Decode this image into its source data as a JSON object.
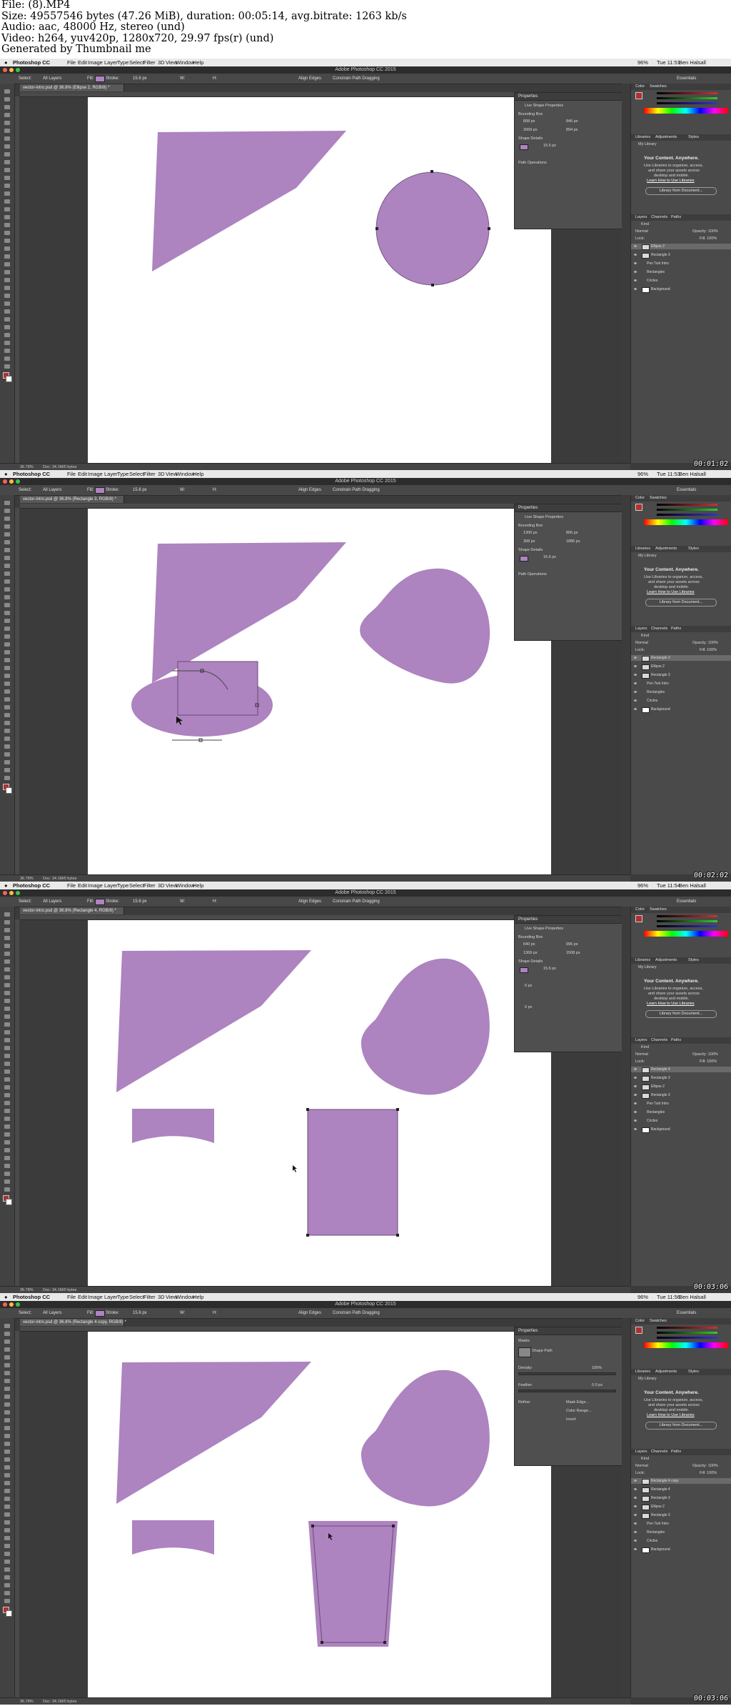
{
  "header": {
    "lines": [
      "File: (8).MP4",
      "Size: 49557546 bytes (47.26 MiB), duration: 00:05:14, avg.bitrate: 1263 kb/s",
      "Audio: aac, 48000 Hz, stereo (und)",
      "Video: h264, yuv420p, 1280x720, 29.97 fps(r) (und)",
      "Generated by Thumbnail me"
    ]
  },
  "app": {
    "title": "Adobe Photoshop CC 2015",
    "app_name": "Photoshop CC",
    "menus": [
      "File",
      "Edit",
      "Image",
      "Layer",
      "Type",
      "Select",
      "Filter",
      "3D",
      "View",
      "Window",
      "Help"
    ],
    "user": "Ben Halsall",
    "battery": "96%",
    "workspace": "Essentials",
    "options": {
      "select_label": "Select:",
      "select_value": "All Layers",
      "fill_label": "Fill:",
      "stroke_label": "Stroke:",
      "stroke_width": "15.6 px",
      "w_label": "W:",
      "h_label": "H:",
      "align_edges": "Align Edges",
      "constrain": "Constrain Path Dragging"
    },
    "accent_purple": "#ad83c0"
  },
  "panels": {
    "color_tab": "Color",
    "swatches_tab": "Swatches",
    "libraries_tab": "Libraries",
    "adjustments_tab": "Adjustments",
    "styles_tab": "Styles",
    "my_library": "My Library",
    "your_content": "Your Content. Anywhere.",
    "lib_text_1": "Use Libraries to organize, access,",
    "lib_text_2": "and share your assets across",
    "lib_text_3": "desktop and mobile.",
    "learn_link": "Learn How to Use Libraries",
    "lib_button": "Library from Document...",
    "layers_tab": "Layers",
    "channels_tab": "Channels",
    "paths_tab": "Paths",
    "kind": "Kind",
    "blend": "Normal",
    "opacity": "Opacity: 100%",
    "fill": "Fill: 100%",
    "lock": "Lock:"
  },
  "properties_panel": {
    "title": "Properties",
    "live_shape": "Live Shape Properties",
    "bounding_box": "Bounding Box",
    "shape_details": "Shape Details",
    "path_ops": "Path Operations",
    "stroke": "15.6 px",
    "masks": "Masks",
    "shape_path": "Shape Path",
    "density": "Density:",
    "density_value": "100%",
    "feather": "Feather:",
    "feather_value": "0.0 px",
    "refine": "Refine:",
    "mask_edge": "Mask Edge...",
    "color_range": "Color Range...",
    "invert": "Invert"
  },
  "frames": [
    {
      "timestamp": "00:01:02",
      "clock": "Tue 11:51",
      "doc_tab": "vector-intro.psd @ 36.8% (Ellipse 2, RGB/8) *",
      "zoom": "36.78%",
      "doc_info": "Doc: 34.1M/0 bytes",
      "props_mode": "live",
      "props_values": {
        "w": "808 px",
        "h": "846 px",
        "x": "2069 px",
        "y": "894 px"
      },
      "layers": [
        "Ellipse 2",
        "Rectangle 3",
        "Pen Tool Intro",
        "Rectangles",
        "Circles",
        "Background"
      ],
      "selected_layer": 0
    },
    {
      "timestamp": "00:02:02",
      "clock": "Tue 11:53",
      "doc_tab": "vector-intro.psd @ 36.8% (Rectangle 3, RGB/8) *",
      "zoom": "36.78%",
      "doc_info": "Doc: 34.1M/0 bytes",
      "props_mode": "live",
      "props_values": {
        "w": "1300 px",
        "h": "806 px",
        "x": "308 px",
        "y": "1886 px"
      },
      "layers": [
        "Rectangle 3",
        "Ellipse 2",
        "Rectangle 3",
        "Pen Tool Intro",
        "Rectangles",
        "Circles",
        "Background"
      ],
      "selected_layer": 0
    },
    {
      "timestamp": "00:03:06",
      "clock": "Tue 11:54",
      "doc_tab": "vector-intro.psd @ 36.8% (Rectangle 4, RGB/8) *",
      "zoom": "36.78%",
      "doc_info": "Doc: 34.1M/0 bytes",
      "props_mode": "rect",
      "props_values": {
        "w": "640 px",
        "h": "996 px",
        "x": "1369 px",
        "y": "1508 px",
        "corner": "0 px"
      },
      "layers": [
        "Rectangle 4",
        "Rectangle 3",
        "Ellipse 2",
        "Rectangle 3",
        "Pen Tool Intro",
        "Rectangles",
        "Circles",
        "Background"
      ],
      "selected_layer": 0
    },
    {
      "timestamp": "00:03:06",
      "clock": "Tue 11:56",
      "doc_tab": "vector-intro.psd @ 36.8% (Rectangle 4 copy, RGB/8) *",
      "zoom": "36.78%",
      "doc_info": "Doc: 34.1M/0 bytes",
      "props_mode": "masks",
      "props_values": {
        "w": "",
        "h": "",
        "x": "",
        "y": ""
      },
      "layers": [
        "Rectangle 4 copy",
        "Rectangle 4",
        "Rectangle 3",
        "Ellipse 2",
        "Rectangle 3",
        "Pen Tool Intro",
        "Rectangles",
        "Circles",
        "Background"
      ],
      "selected_layer": 0
    }
  ]
}
